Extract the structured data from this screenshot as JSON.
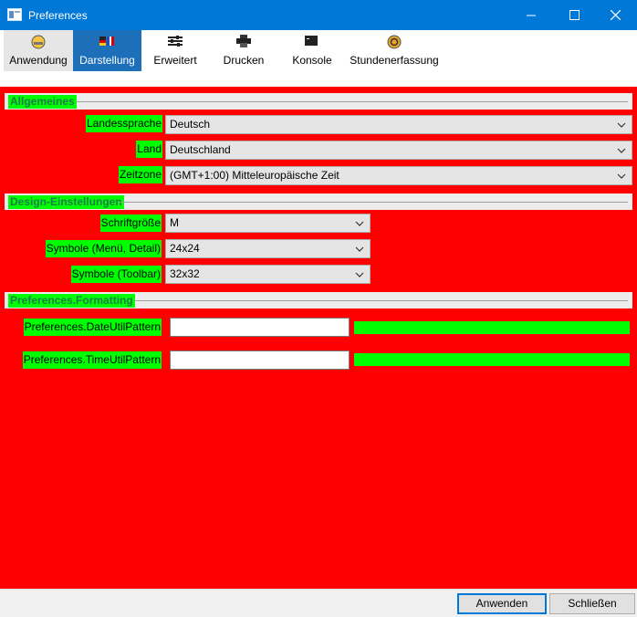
{
  "window": {
    "title": "Preferences"
  },
  "toolbar": {
    "items": [
      {
        "label": "Anwendung",
        "icon": "clock-icon"
      },
      {
        "label": "Darstellung",
        "icon": "flag-icon"
      },
      {
        "label": "Erweitert",
        "icon": "sliders-icon"
      },
      {
        "label": "Drucken",
        "icon": "printer-icon"
      },
      {
        "label": "Konsole",
        "icon": "console-icon"
      },
      {
        "label": "Stundenerfassung",
        "icon": "coin-icon"
      }
    ],
    "active": "Darstellung"
  },
  "sections": {
    "general": {
      "title": "Allgemeines",
      "language_label": "Landessprache",
      "language_value": "Deutsch",
      "country_label": "Land",
      "country_value": "Deutschland",
      "timezone_label": "Zeitzone",
      "timezone_value": "(GMT+1:00) Mitteleuropäische Zeit"
    },
    "design": {
      "title": "Design-Einstellungen",
      "fontsize_label": "Schriftgröße",
      "fontsize_value": "M",
      "symbols_menu_label": "Symbole (Menü, Detail)",
      "symbols_menu_value": "24x24",
      "symbols_toolbar_label": "Symbole (Toolbar)",
      "symbols_toolbar_value": "32x32"
    },
    "formatting": {
      "title": "Preferences.Formatting",
      "date_label": "Preferences.DateUtilPattern",
      "date_value": "",
      "time_label": "Preferences.TimeUtilPattern",
      "time_value": ""
    }
  },
  "footer": {
    "apply_label": "Anwenden",
    "close_label": "Schließen"
  },
  "colors": {
    "titlebar": "#0078d7",
    "content_background": "#ff0000",
    "label_highlight": "#00ff00",
    "section_title_text": "#1f7a50",
    "active_tab": "#1c6fb8"
  }
}
